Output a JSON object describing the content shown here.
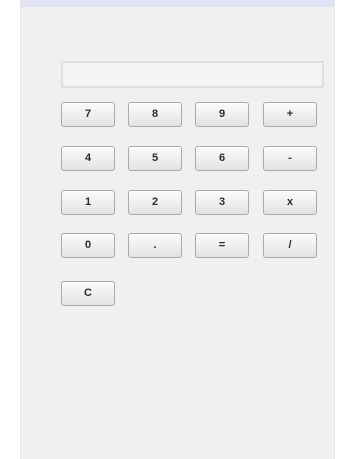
{
  "display": {
    "value": ""
  },
  "keypad": {
    "rows": [
      [
        "7",
        "8",
        "9",
        "+"
      ],
      [
        "4",
        "5",
        "6",
        "-"
      ],
      [
        "1",
        "2",
        "3",
        "x"
      ],
      [
        "0",
        ".",
        "=",
        "/"
      ],
      [
        "C"
      ]
    ]
  },
  "colors": {
    "window_background": "#f0f0f0",
    "title_strip": "#e2e2f6",
    "button_border": "#a9a9a9"
  }
}
